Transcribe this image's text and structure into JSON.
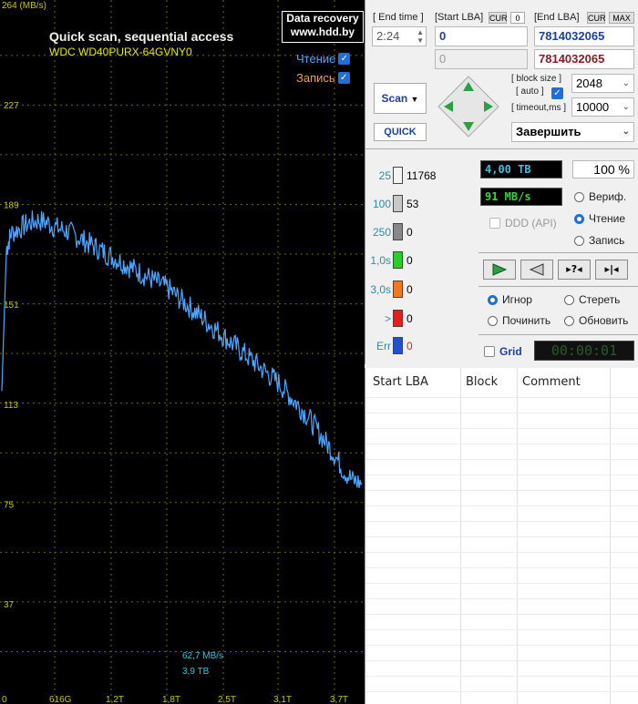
{
  "graph": {
    "y_unit": "264 (MB/s)",
    "title": "Quick scan, sequential access",
    "model": "WDC WD40PURX-64GVNY0",
    "logo_line1": "Data recovery",
    "logo_line2": "www.hdd.by",
    "legend_read": "Чтение",
    "legend_write": "Запись",
    "current_speed": "62,7 MB/s",
    "current_pos": "3,9 TB",
    "colors": {
      "read": "#4da6ff",
      "write": "#e8a060",
      "grid": "#a0a000"
    }
  },
  "chart_data": {
    "type": "line",
    "ylim": [
      0,
      264
    ],
    "y_ticks": [
      "227",
      "189",
      "151",
      "113",
      "75",
      "37"
    ],
    "x_ticks": [
      "0",
      "616G",
      "1,2T",
      "1,8T",
      "2,5T",
      "3,1T",
      "3,7T"
    ],
    "series": [
      {
        "name": "Чтение",
        "x_tb": [
          0,
          0.05,
          0.1,
          0.2,
          0.3,
          0.4,
          0.5,
          0.6,
          0.7,
          0.8,
          0.9,
          1.0,
          1.1,
          1.2,
          1.3,
          1.4,
          1.5,
          1.6,
          1.7,
          1.8,
          1.9,
          2.0,
          2.1,
          2.2,
          2.3,
          2.4,
          2.5,
          2.6,
          2.7,
          2.8,
          2.9,
          3.0,
          3.1,
          3.2,
          3.3,
          3.4,
          3.5,
          3.6,
          3.7,
          3.8,
          3.9
        ],
        "values": [
          118,
          172,
          178,
          180,
          182,
          183,
          182,
          180,
          179,
          177,
          175,
          173,
          171,
          169,
          167,
          165,
          163,
          161,
          159,
          157,
          154,
          151,
          148,
          145,
          142,
          139,
          136,
          133,
          130,
          127,
          124,
          121,
          117,
          113,
          109,
          104,
          99,
          94,
          88,
          84,
          83
        ]
      }
    ]
  },
  "panel": {
    "end_time_label": "[ End time ]",
    "end_time_value": "2:24",
    "start_lba_label": "[Start LBA]",
    "cur_label": "CUR",
    "cur_value": "0",
    "end_lba_label": "[End LBA]",
    "cur2_label": "CUR",
    "max_label": "MAX",
    "start_lba": "0",
    "end_lba": "7814032065",
    "start_lba_cur": "0",
    "end_lba_max": "7814032065",
    "scan_button": "Scan",
    "quick_button": "QUICK",
    "block_size_label": "[ block size ]",
    "auto_label": "[ auto ]",
    "timeout_label": "[ timeout,ms ]",
    "block_size": "2048",
    "timeout": "10000",
    "finish_select": "Завершить",
    "stats": [
      {
        "label": "25",
        "count": "11768",
        "color": "#f4f4f4"
      },
      {
        "label": "100",
        "count": "53",
        "color": "#c8c8c8"
      },
      {
        "label": "250",
        "count": "0",
        "color": "#888888"
      },
      {
        "label": "1,0s",
        "count": "0",
        "color": "#2dcc2d"
      },
      {
        "label": "3,0s",
        "count": "0",
        "color": "#f07820"
      },
      {
        "label": ">",
        "count": "0",
        "color": "#e02020"
      },
      {
        "label": "Err",
        "count": "0",
        "color": "#2050d0"
      }
    ],
    "size_value": "4,00 TB",
    "percent_value": "100",
    "percent_unit": "%",
    "speed_value": "91 MB/s",
    "ddd_label": "DDD (API)",
    "mode_verify": "Вериф.",
    "mode_read": "Чтение",
    "mode_write": "Запись",
    "opt_ignore": "Игнор",
    "opt_erase": "Стереть",
    "opt_repair": "Починить",
    "opt_refresh": "Обновить",
    "grid_label": "Grid",
    "timer": "00:00:01"
  },
  "table": {
    "col_start": "Start LBA",
    "col_block": "Block",
    "col_comment": "Comment"
  }
}
